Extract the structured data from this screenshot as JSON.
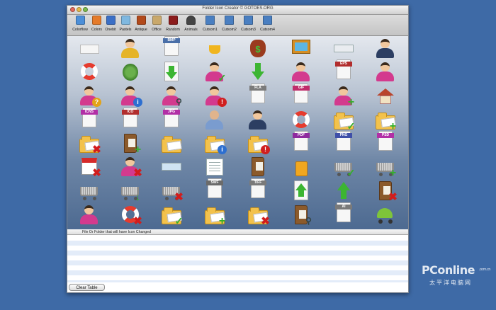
{
  "window": {
    "title": "Folder Icon Creator © GOTOES.ORG"
  },
  "toolbar": {
    "items": [
      {
        "label": "Colorflow",
        "icon": "colorflow-icon",
        "color": "#4d8fd8"
      },
      {
        "label": "Colors",
        "icon": "colors-icon",
        "color": "#e57b2a"
      },
      {
        "label": "Onebit",
        "icon": "onebit-icon",
        "color": "#3b6fc6"
      },
      {
        "label": "Pastels",
        "icon": "pastels-icon",
        "color": "#7fb8e0"
      },
      {
        "label": "Antique",
        "icon": "antique-icon",
        "color": "#b24a1b"
      },
      {
        "label": "Office",
        "icon": "office-icon",
        "color": "#c9a86b"
      },
      {
        "label": "Random",
        "icon": "random-icon",
        "color": "#8b1b1b"
      },
      {
        "label": "Animals",
        "icon": "animals-icon",
        "color": "#444444"
      },
      {
        "label": "Cutsom1",
        "icon": "folder-icon",
        "color": "#4a7fc1"
      },
      {
        "label": "Cutsom2",
        "icon": "folder-icon",
        "color": "#4a7fc1"
      },
      {
        "label": "Cutsom3",
        "icon": "folder-icon",
        "color": "#4a7fc1"
      },
      {
        "label": "Cutsom4",
        "icon": "folder-icon",
        "color": "#4a7fc1"
      }
    ]
  },
  "icons": {
    "doc_tags": {
      "bmp": "BMP",
      "eps": "EPS",
      "fla": "FLA",
      "gif": "GIF",
      "icns": "ICNS",
      "ico": "ICO",
      "jpg": "JPG",
      "pdf": "PDF",
      "png": "PNG",
      "psd": "PSD",
      "swf": "SWF",
      "tiff": "TIFF",
      "ai": "AI"
    },
    "money_symbol": "$"
  },
  "panel": {
    "header": "File Or Folder that will have Icon Changed",
    "clear_button": "Clear Table"
  },
  "watermark": {
    "brand": "PConline",
    "domain": ".com.cn",
    "tagline": "太平洋电脑网"
  }
}
